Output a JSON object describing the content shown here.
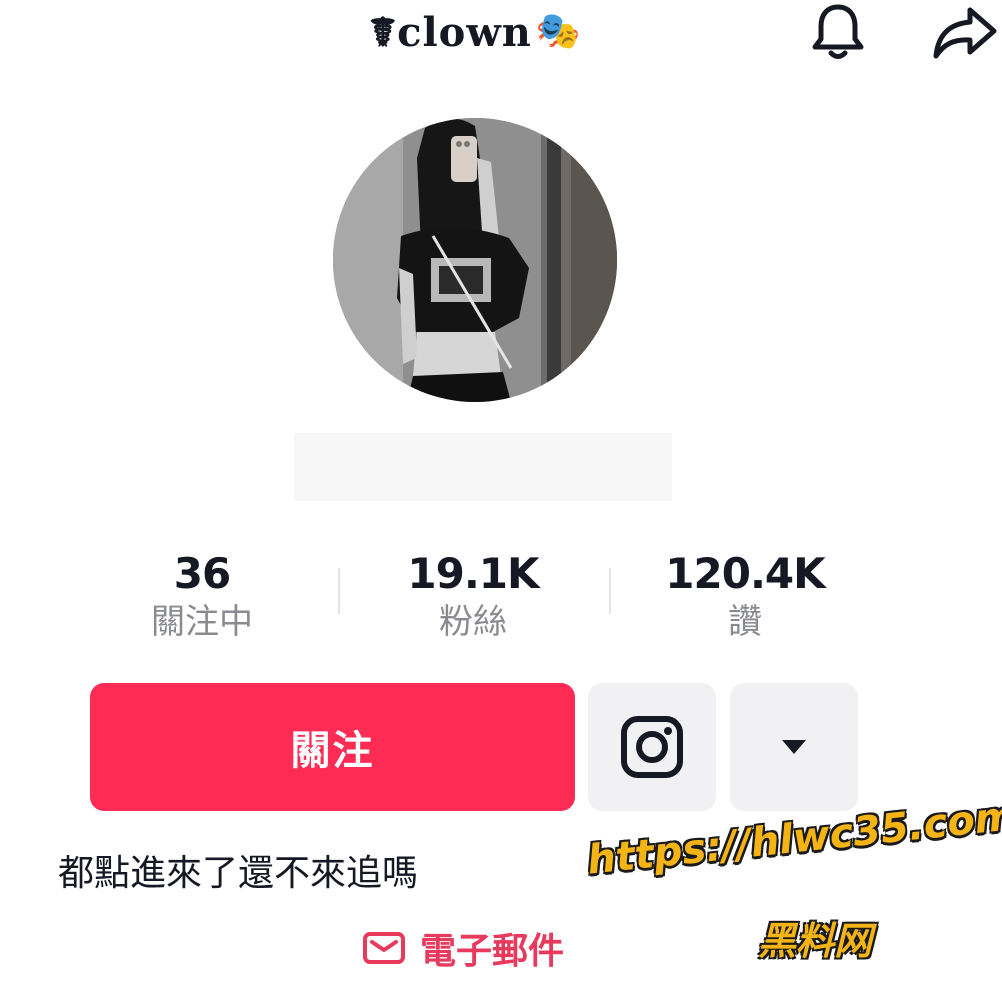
{
  "header": {
    "title": "☤clown",
    "title_emoji": "🎭",
    "icons": [
      "bell-icon",
      "share-icon"
    ]
  },
  "profile": {
    "avatar": "profile-avatar"
  },
  "stats": [
    {
      "value": "36",
      "label": "關注中"
    },
    {
      "value": "19.1K",
      "label": "粉絲"
    },
    {
      "value": "120.4K",
      "label": "讚"
    }
  ],
  "actions": {
    "follow_label": "關注",
    "instagram_icon": "instagram-icon",
    "more_icon": "caret-down-icon"
  },
  "bio": "都點進來了還不來追嗎",
  "email": {
    "icon": "mail-icon",
    "label": "電子郵件"
  },
  "watermark": {
    "url": "https://hlwc35.com",
    "site_name": "黑料网"
  },
  "colors": {
    "accent": "#fe2c55",
    "email_text": "#e73a5c",
    "secondary_text": "#8a8b91",
    "button_bg": "#f1f1f3",
    "watermark": "#f5b416"
  }
}
